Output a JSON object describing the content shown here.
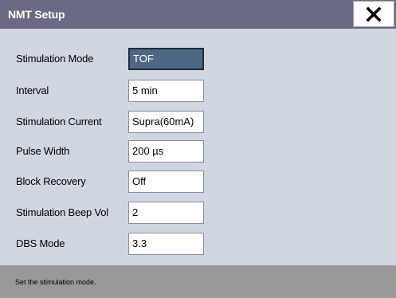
{
  "window": {
    "title": "NMT Setup",
    "close_icon": "close-x-icon"
  },
  "settings": [
    {
      "key": "stimulation_mode",
      "label": "Stimulation Mode",
      "value": "TOF",
      "selected": true
    },
    {
      "key": "interval",
      "label": "Interval",
      "value": "5 min",
      "selected": false
    },
    {
      "key": "stimulation_current",
      "label": "Stimulation Current",
      "value": "Supra(60mA)",
      "selected": false
    },
    {
      "key": "pulse_width",
      "label": "Pulse Width",
      "value": "200 µs",
      "selected": false
    },
    {
      "key": "block_recovery",
      "label": "Block Recovery",
      "value": "Off",
      "selected": false
    },
    {
      "key": "stimulation_beep_vol",
      "label": "Stimulation Beep Vol",
      "value": "2",
      "selected": false
    },
    {
      "key": "dbs_mode",
      "label": "DBS Mode",
      "value": "3.3",
      "selected": false
    }
  ],
  "status": {
    "text": "Set the stimulation mode."
  },
  "colors": {
    "title_bar": "#6b6a85",
    "dialog_bg": "#cfd6e1",
    "selected_field": "#4e6784",
    "status_bar": "#999999"
  }
}
